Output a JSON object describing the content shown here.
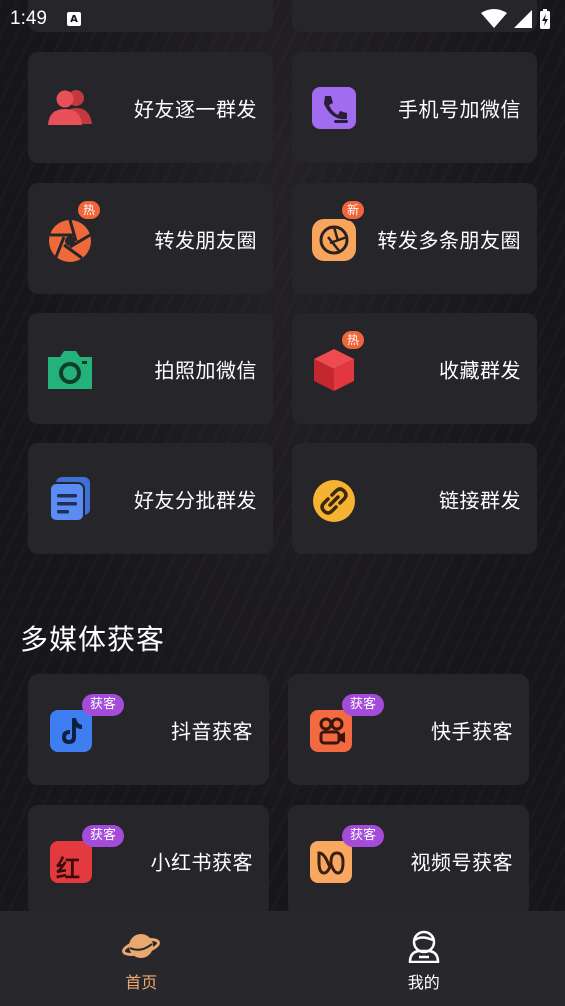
{
  "status_bar": {
    "time": "1:49",
    "notification_letter": "A"
  },
  "colors": {
    "background": "#17161b",
    "card": "#26252a",
    "tabbar": "#28272b",
    "tab_active": "#e8a870",
    "tab_inactive": "#ffffff",
    "badge_hot": "#f0653a",
    "badge_get": "#a44bd9"
  },
  "tools": [
    {
      "label": "好友逐一群发",
      "icon": "users-group-icon"
    },
    {
      "label": "手机号加微信",
      "icon": "phone-icon"
    },
    {
      "label": "转发朋友圈",
      "icon": "aperture-icon",
      "badge": "热"
    },
    {
      "label": "转发多条朋友圈",
      "icon": "aperture-multi-icon",
      "badge": "新"
    },
    {
      "label": "拍照加微信",
      "icon": "camera-icon"
    },
    {
      "label": "收藏群发",
      "icon": "cube-icon",
      "badge": "热"
    },
    {
      "label": "好友分批群发",
      "icon": "document-stack-icon"
    },
    {
      "label": "链接群发",
      "icon": "link-icon"
    }
  ],
  "media_section": {
    "title": "多媒体获客",
    "items": [
      {
        "label": "抖音获客",
        "icon": "douyin-icon",
        "badge": "获客"
      },
      {
        "label": "快手获客",
        "icon": "kuaishou-icon",
        "badge": "获客"
      },
      {
        "label": "小红书获客",
        "icon": "xiaohongshu-icon",
        "badge": "获客",
        "icon_text": "红"
      },
      {
        "label": "视频号获客",
        "icon": "channels-icon",
        "badge": "获客"
      }
    ]
  },
  "tabbar": {
    "home": {
      "label": "首页",
      "icon": "planet-icon"
    },
    "mine": {
      "label": "我的",
      "icon": "user-icon"
    }
  }
}
